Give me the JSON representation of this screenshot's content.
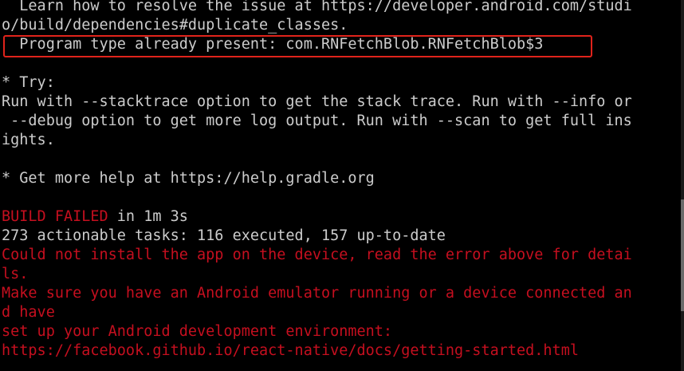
{
  "terminal": {
    "lines": [
      {
        "text": "  Learn how to resolve the issue at https://developer.android.com/studi",
        "color": "default"
      },
      {
        "text": "o/build/dependencies#duplicate_classes.",
        "color": "default"
      },
      {
        "text": "  Program type already present: com.RNFetchBlob.RNFetchBlob$3",
        "color": "default"
      },
      {
        "text": "",
        "color": "default"
      },
      {
        "text": "* Try:",
        "color": "default"
      },
      {
        "text": "Run with --stacktrace option to get the stack trace. Run with --info or",
        "color": "default"
      },
      {
        "text": " --debug option to get more log output. Run with --scan to get full ins",
        "color": "default"
      },
      {
        "text": "ights.",
        "color": "default"
      },
      {
        "text": "",
        "color": "default"
      },
      {
        "text": "* Get more help at https://help.gradle.org",
        "color": "default"
      },
      {
        "text": "",
        "color": "default"
      },
      {
        "text": "BUILD FAILED",
        "suffix": " in 1m 3s",
        "color": "mixed"
      },
      {
        "text": "273 actionable tasks: 116 executed, 157 up-to-date",
        "color": "default"
      },
      {
        "text": "Could not install the app on the device, read the error above for detai",
        "color": "red"
      },
      {
        "text": "ls.",
        "color": "red"
      },
      {
        "text": "Make sure you have an Android emulator running or a device connected an",
        "color": "red"
      },
      {
        "text": "d have",
        "color": "red"
      },
      {
        "text": "set up your Android development environment:",
        "color": "red"
      },
      {
        "text": "https://facebook.github.io/react-native/docs/getting-started.html",
        "color": "red"
      }
    ]
  },
  "colors": {
    "background": "#000000",
    "default_text": "#cccccc",
    "error_text": "#c50f1f",
    "highlight_border": "#e0231b"
  }
}
